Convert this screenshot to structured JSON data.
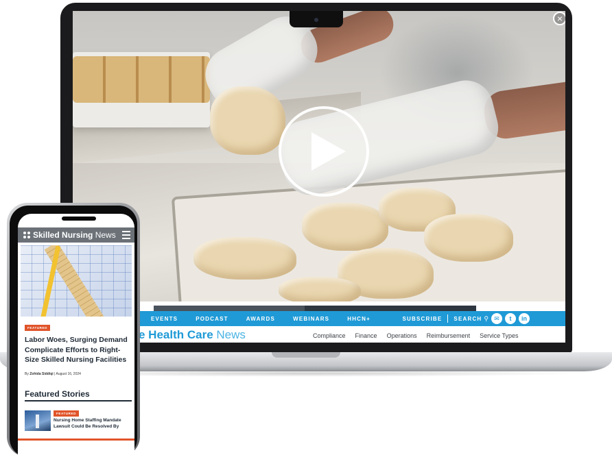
{
  "video": {
    "play_icon": "play-icon",
    "close_icon": "close-icon"
  },
  "desktop_site": {
    "nav": {
      "items": [
        "EVENTS",
        "PODCAST",
        "AWARDS",
        "WEBINARS",
        "HHCN+"
      ],
      "subscribe": "SUBSCRIBE",
      "search": "SEARCH",
      "social_icons": [
        "email-icon",
        "twitter-icon",
        "linkedin-icon"
      ]
    },
    "brand": {
      "bold": "e Health Care",
      "light": "News"
    },
    "sub_links": [
      "Compliance",
      "Finance",
      "Operations",
      "Reimbursement",
      "Service Types"
    ]
  },
  "mobile_site": {
    "brand": {
      "part1": "Skilled",
      "part2": "Nursing",
      "part3": "News"
    },
    "hero_tag": "FEATURED",
    "headline": "Labor Woes, Surging Demand Complicate Efforts to Right-Size Skilled Nursing Facilities",
    "byline": {
      "prefix": "By",
      "author": "Zohida Siddiqi",
      "date": "August 16, 2024"
    },
    "featured_heading": "Featured Stories",
    "featured_story": {
      "tag": "FEATURED",
      "title": "Nursing Home Staffing Mandate Lawsuit Could Be Resolved By"
    }
  },
  "colors": {
    "brand_blue": "#1f9ad6",
    "accent_orange": "#e0542a",
    "header_gray": "#6b7177",
    "navy_text": "#1f2a36"
  }
}
